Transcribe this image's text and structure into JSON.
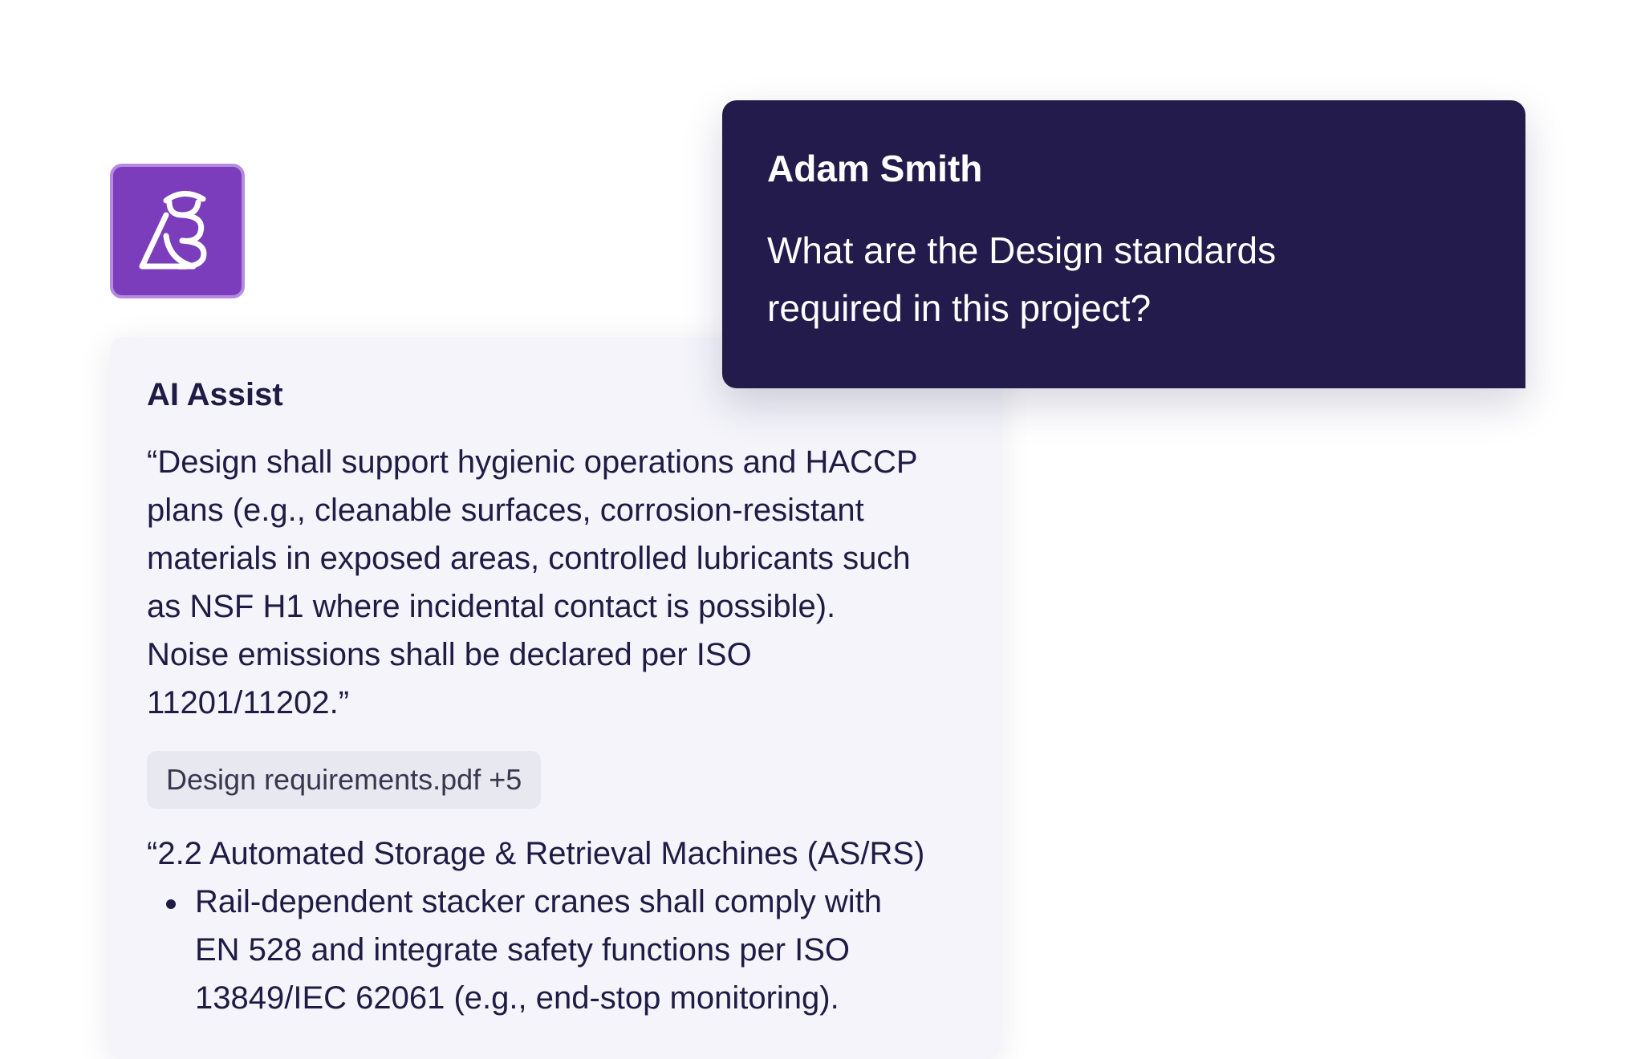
{
  "logo": {
    "icon": "owl-logo-icon",
    "background": "#7b3dbb"
  },
  "user_message": {
    "author": "Adam Smith",
    "text": "What are the Design standards\nrequired in this project?",
    "background": "#221b4b"
  },
  "assist": {
    "title": "AI Assist",
    "quote": "“Design shall support hygienic operations and HACCP\nplans (e.g., cleanable surfaces, corrosion-resistant\nmaterials in exposed areas, controlled lubricants such\nas NSF H1 where incidental contact is possible).\nNoise emissions shall be declared per ISO\n11201/11202.”",
    "source_chip": "Design requirements.pdf +5",
    "section_heading": "“2.2 Automated Storage & Retrieval Machines (AS/RS)",
    "bullets": [
      {
        "text": "Rail-dependent stacker cranes shall comply with\nEN 528 and integrate safety functions per ISO\n13849/IEC 62061 (e.g., end-stop monitoring)."
      }
    ]
  }
}
